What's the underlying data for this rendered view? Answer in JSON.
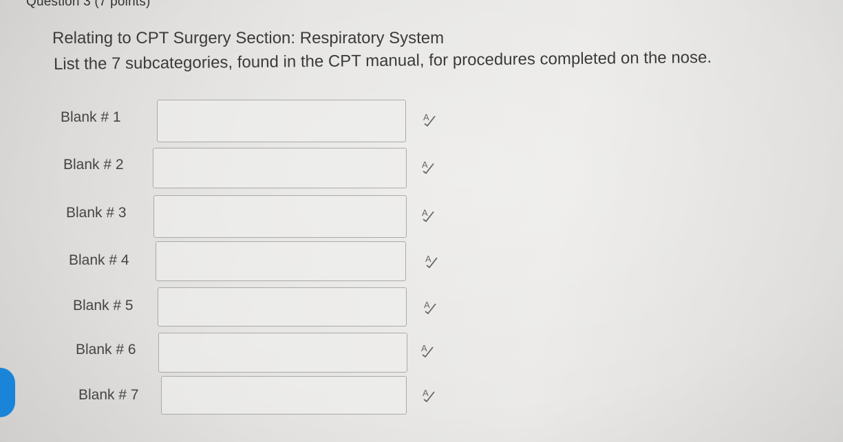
{
  "question": {
    "header": "Question 3 (7 points)",
    "title": "Relating to CPT Surgery Section: Respiratory System",
    "prompt": "List the 7 subcategories, found in the CPT manual, for procedures completed on the nose."
  },
  "blanks": [
    {
      "label": "Blank # 1",
      "value": ""
    },
    {
      "label": "Blank # 2",
      "value": ""
    },
    {
      "label": "Blank # 3",
      "value": ""
    },
    {
      "label": "Blank # 4",
      "value": ""
    },
    {
      "label": "Blank # 5",
      "value": ""
    },
    {
      "label": "Blank # 6",
      "value": ""
    },
    {
      "label": "Blank # 7",
      "value": ""
    }
  ],
  "icons": {
    "spellcheck": "spellcheck-icon"
  },
  "colors": {
    "accent": "#1a84d8",
    "input_border": "#a9a9a7",
    "text": "#3b3b3b"
  }
}
